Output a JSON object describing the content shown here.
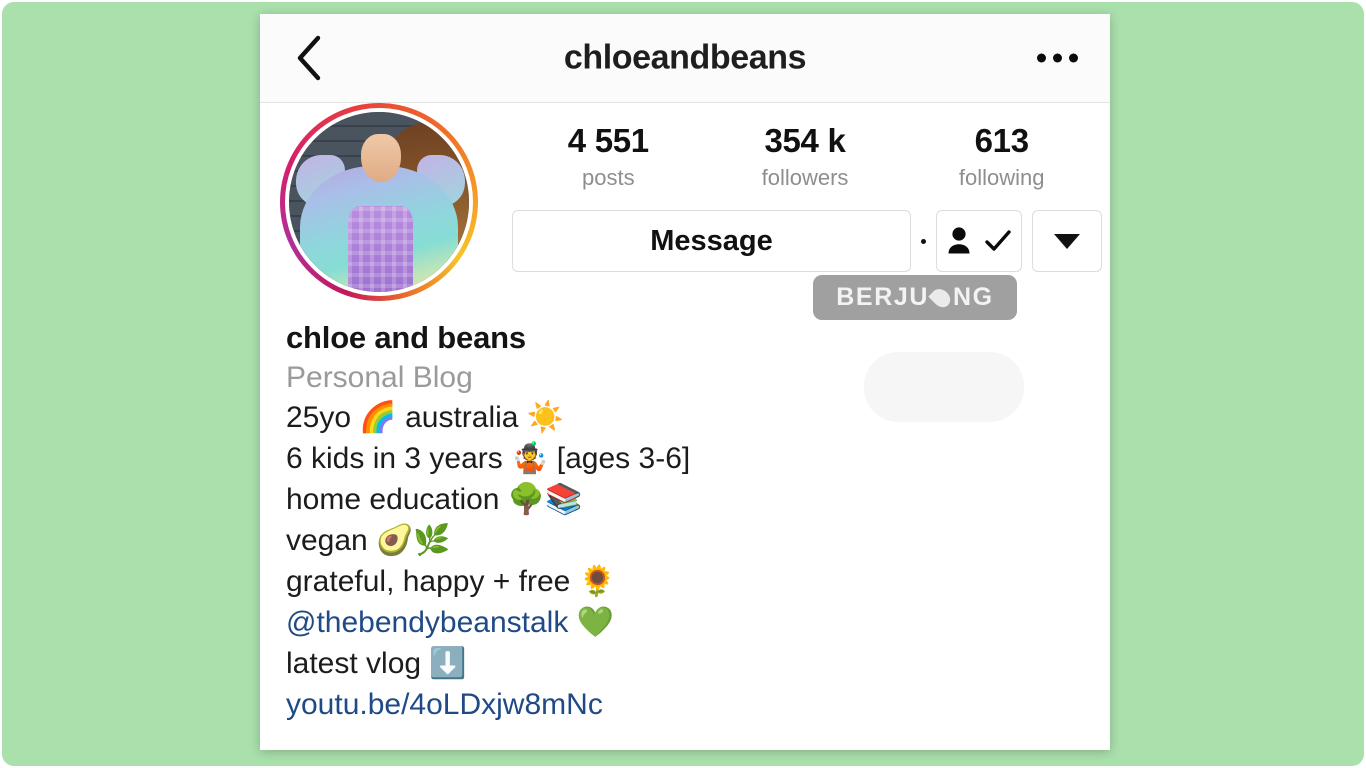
{
  "navbar": {
    "back_icon": "chevron-left-icon",
    "title": "chloeandbeans",
    "more_icon": "more-options-icon"
  },
  "profile": {
    "avatar_alt": "chloeandbeans profile photo",
    "has_story_ring": true,
    "stats": [
      {
        "value": "4 551",
        "label": "posts"
      },
      {
        "value": "354 k",
        "label": "followers"
      },
      {
        "value": "613",
        "label": "following"
      }
    ],
    "actions": {
      "message_label": "Message",
      "following_icon": "person-check-icon",
      "dropdown_icon": "caret-down-icon"
    },
    "bio": {
      "name": "chloe and beans",
      "category": "Personal Blog",
      "lines": [
        {
          "text": "25yo 🌈 australia ☀️",
          "link": false
        },
        {
          "text": "6 kids in 3 years 🤹 [ages 3-6]",
          "link": false
        },
        {
          "text": "home education 🌳📚",
          "link": false
        },
        {
          "text": "vegan 🥑🌿",
          "link": false
        },
        {
          "text": "grateful, happy + free 🌻",
          "link": false
        },
        {
          "text": "@thebendybeanstalk 💚",
          "link": true
        },
        {
          "text": "latest vlog ⬇️",
          "link": false
        },
        {
          "text": "youtu.be/4oLDxjw8mNc",
          "link": true
        }
      ]
    }
  },
  "watermark": {
    "part1": "BERJU",
    "part2": "NG",
    "drop_icon": "water-drop-icon"
  },
  "colors": {
    "page_background": "#a9e0ac",
    "card_background": "#ffffff",
    "link": "#1f4a86",
    "muted_text": "#8e8e8e",
    "primary_text": "#141414",
    "border": "#dcdcdc"
  }
}
